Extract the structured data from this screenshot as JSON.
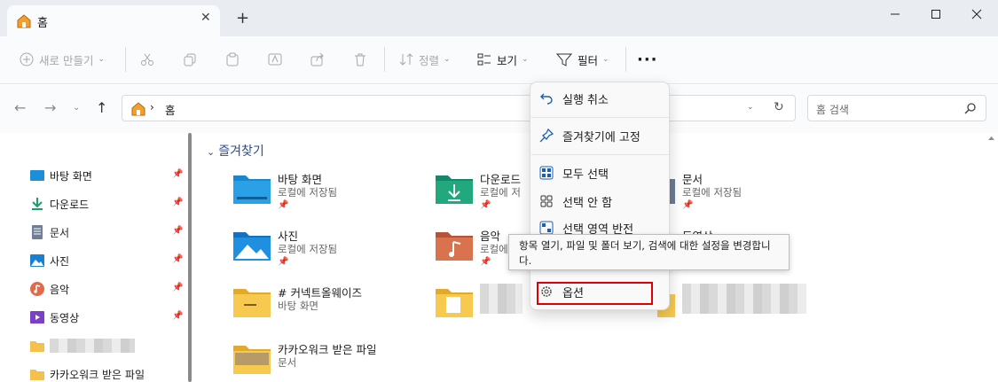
{
  "window": {
    "tab_title": "홈",
    "tab_close": "✕",
    "new_tab": "+"
  },
  "toolbar": {
    "new_label": "새로 만들기",
    "sort_label": "정렬",
    "view_label": "보기",
    "filter_label": "필터",
    "more_label": "···"
  },
  "address": {
    "breadcrumb": "홈",
    "search_placeholder": "홈 검색"
  },
  "sidebar": {
    "items": [
      {
        "label": "바탕 화면"
      },
      {
        "label": "다운로드"
      },
      {
        "label": "문서"
      },
      {
        "label": "사진"
      },
      {
        "label": "음악"
      },
      {
        "label": "동영상"
      },
      {
        "label": ""
      },
      {
        "label": "카카오워크 받은 파일"
      }
    ]
  },
  "main": {
    "section_title": "즐겨찾기",
    "tiles": [
      {
        "name": "바탕 화면",
        "sub": "로컬에 저장됨"
      },
      {
        "name": "다운로드",
        "sub": "로컬에 저"
      },
      {
        "name": "문서",
        "sub": "로컬에 저장됨"
      },
      {
        "name": "사진",
        "sub": "로컬에 저장됨"
      },
      {
        "name": "음악",
        "sub": "로컬에"
      },
      {
        "name": "동영상",
        "sub": ""
      },
      {
        "name": "# 커넥트올웨이즈",
        "sub": "바탕 화면"
      },
      {
        "name": "카카오워크 받은 파일",
        "sub": "문서"
      }
    ]
  },
  "menu": {
    "undo": "실행 취소",
    "pin": "즐겨찾기에 고정",
    "select_all": "모두 선택",
    "select_none": "선택 안 함",
    "invert": "선택 영역 반전",
    "options": "옵션"
  },
  "tooltip": {
    "text": "항목 열기, 파일 및 폴더 보기, 검색에 대한 설정을 변경합니다."
  },
  "colors": {
    "highlight": "#e00000",
    "accent": "#2a4c8c"
  }
}
